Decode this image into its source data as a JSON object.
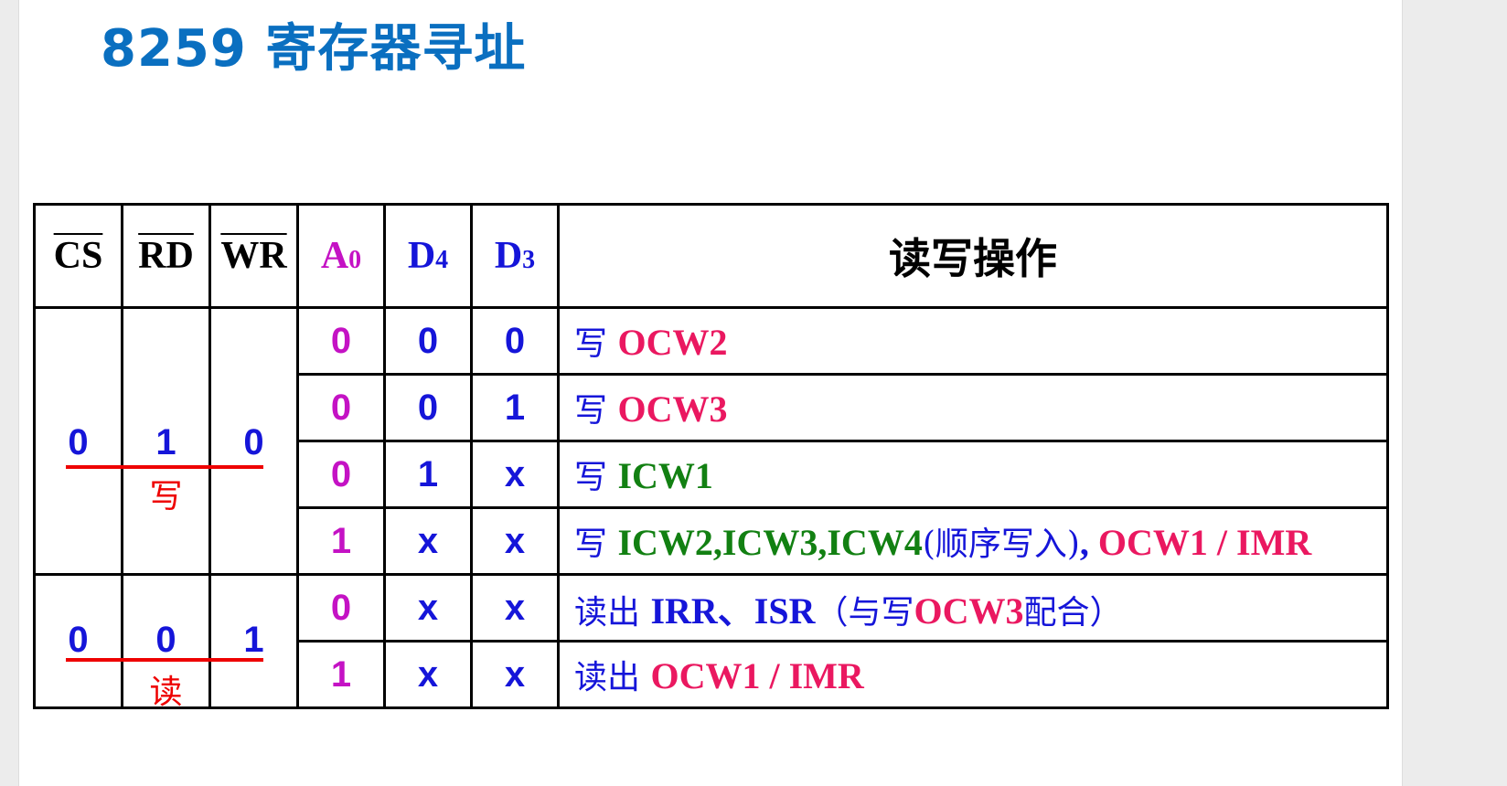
{
  "title": "8259 寄存器寻址",
  "table": {
    "headers": {
      "cs": "CS",
      "rd": "RD",
      "wr": "WR",
      "a0": "A",
      "a0_sub": "0",
      "d4": "D",
      "d4_sub": "4",
      "d3": "D",
      "d3_sub": "3",
      "op": "读写操作"
    },
    "write_group": {
      "cs": "0",
      "rd": "1",
      "wr": "0",
      "label": "写"
    },
    "read_group": {
      "cs": "0",
      "rd": "0",
      "wr": "1",
      "label": "读"
    },
    "rows": [
      {
        "a0": "0",
        "d4": "0",
        "d3": "0",
        "prefix": "写 ",
        "reg": "OCW2"
      },
      {
        "a0": "0",
        "d4": "0",
        "d3": "1",
        "prefix": "写 ",
        "reg": "OCW3"
      },
      {
        "a0": "0",
        "d4": "1",
        "d3": "x",
        "prefix": "写 ",
        "reg": "ICW1"
      },
      {
        "a0": "1",
        "d4": "x",
        "d3": "x",
        "prefix": "写 ",
        "reg": "ICW2,ICW3,ICW4",
        "note": "(顺序写入)",
        "sep": ", ",
        "reg2": "OCW1 / IMR"
      },
      {
        "a0": "0",
        "d4": "x",
        "d3": "x",
        "prefix": "读出 ",
        "reg": "IRR、ISR",
        "note_pre": "（与写",
        "reg2": "OCW3",
        "note_post": "配合）"
      },
      {
        "a0": "1",
        "d4": "x",
        "d3": "x",
        "prefix": "读出 ",
        "reg": "OCW1 / IMR"
      }
    ]
  },
  "colors": {
    "title": "#0a6fc0",
    "a0": "#c412c4",
    "bits": "#1515d9",
    "ocw": "#ea1860",
    "icw": "#128012",
    "label": "#ee0000"
  }
}
